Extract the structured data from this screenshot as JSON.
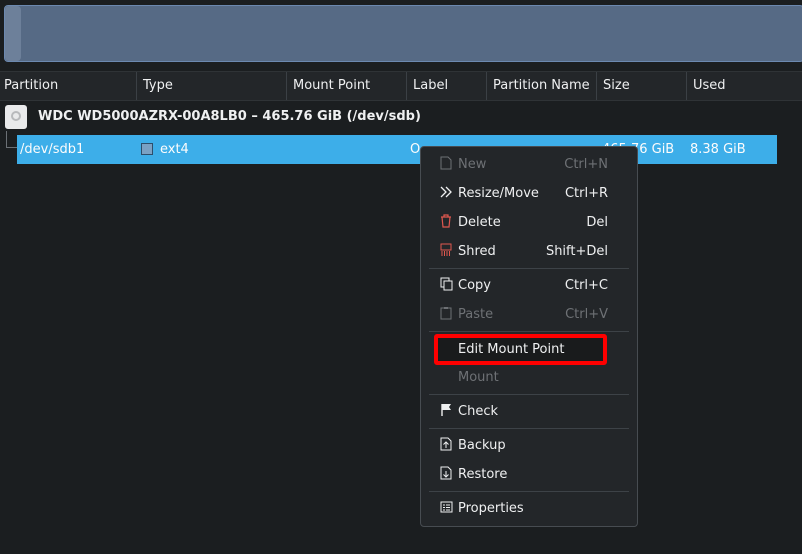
{
  "columns": [
    "Partition",
    "Type",
    "Mount Point",
    "Label",
    "Partition Name",
    "Size",
    "Used"
  ],
  "device": {
    "title": "WDC WD5000AZRX-00A8LB0 – 465.76 GiB (/dev/sdb)",
    "icon": "hard-disk-icon"
  },
  "partition": {
    "name": "/dev/sdb1",
    "type": "ext4",
    "label_partial": "O",
    "size_partial": "465.76 GiB",
    "used": "8.38 GiB",
    "type_color": "#7aa1c4"
  },
  "menu": {
    "new": {
      "label": "New",
      "shortcut": "Ctrl+N"
    },
    "resize": {
      "label": "Resize/Move",
      "shortcut": "Ctrl+R"
    },
    "delete": {
      "label": "Delete",
      "shortcut": "Del"
    },
    "shred": {
      "label": "Shred",
      "shortcut": "Shift+Del"
    },
    "copy": {
      "label": "Copy",
      "shortcut": "Ctrl+C"
    },
    "paste": {
      "label": "Paste",
      "shortcut": "Ctrl+V"
    },
    "edit_mount": {
      "label": "Edit Mount Point"
    },
    "mount": {
      "label": "Mount"
    },
    "check": {
      "label": "Check"
    },
    "backup": {
      "label": "Backup"
    },
    "restore": {
      "label": "Restore"
    },
    "properties": {
      "label": "Properties"
    }
  },
  "colors": {
    "selection": "#3daee9",
    "highlight_box": "#ff0000",
    "background": "#1b1e20"
  }
}
